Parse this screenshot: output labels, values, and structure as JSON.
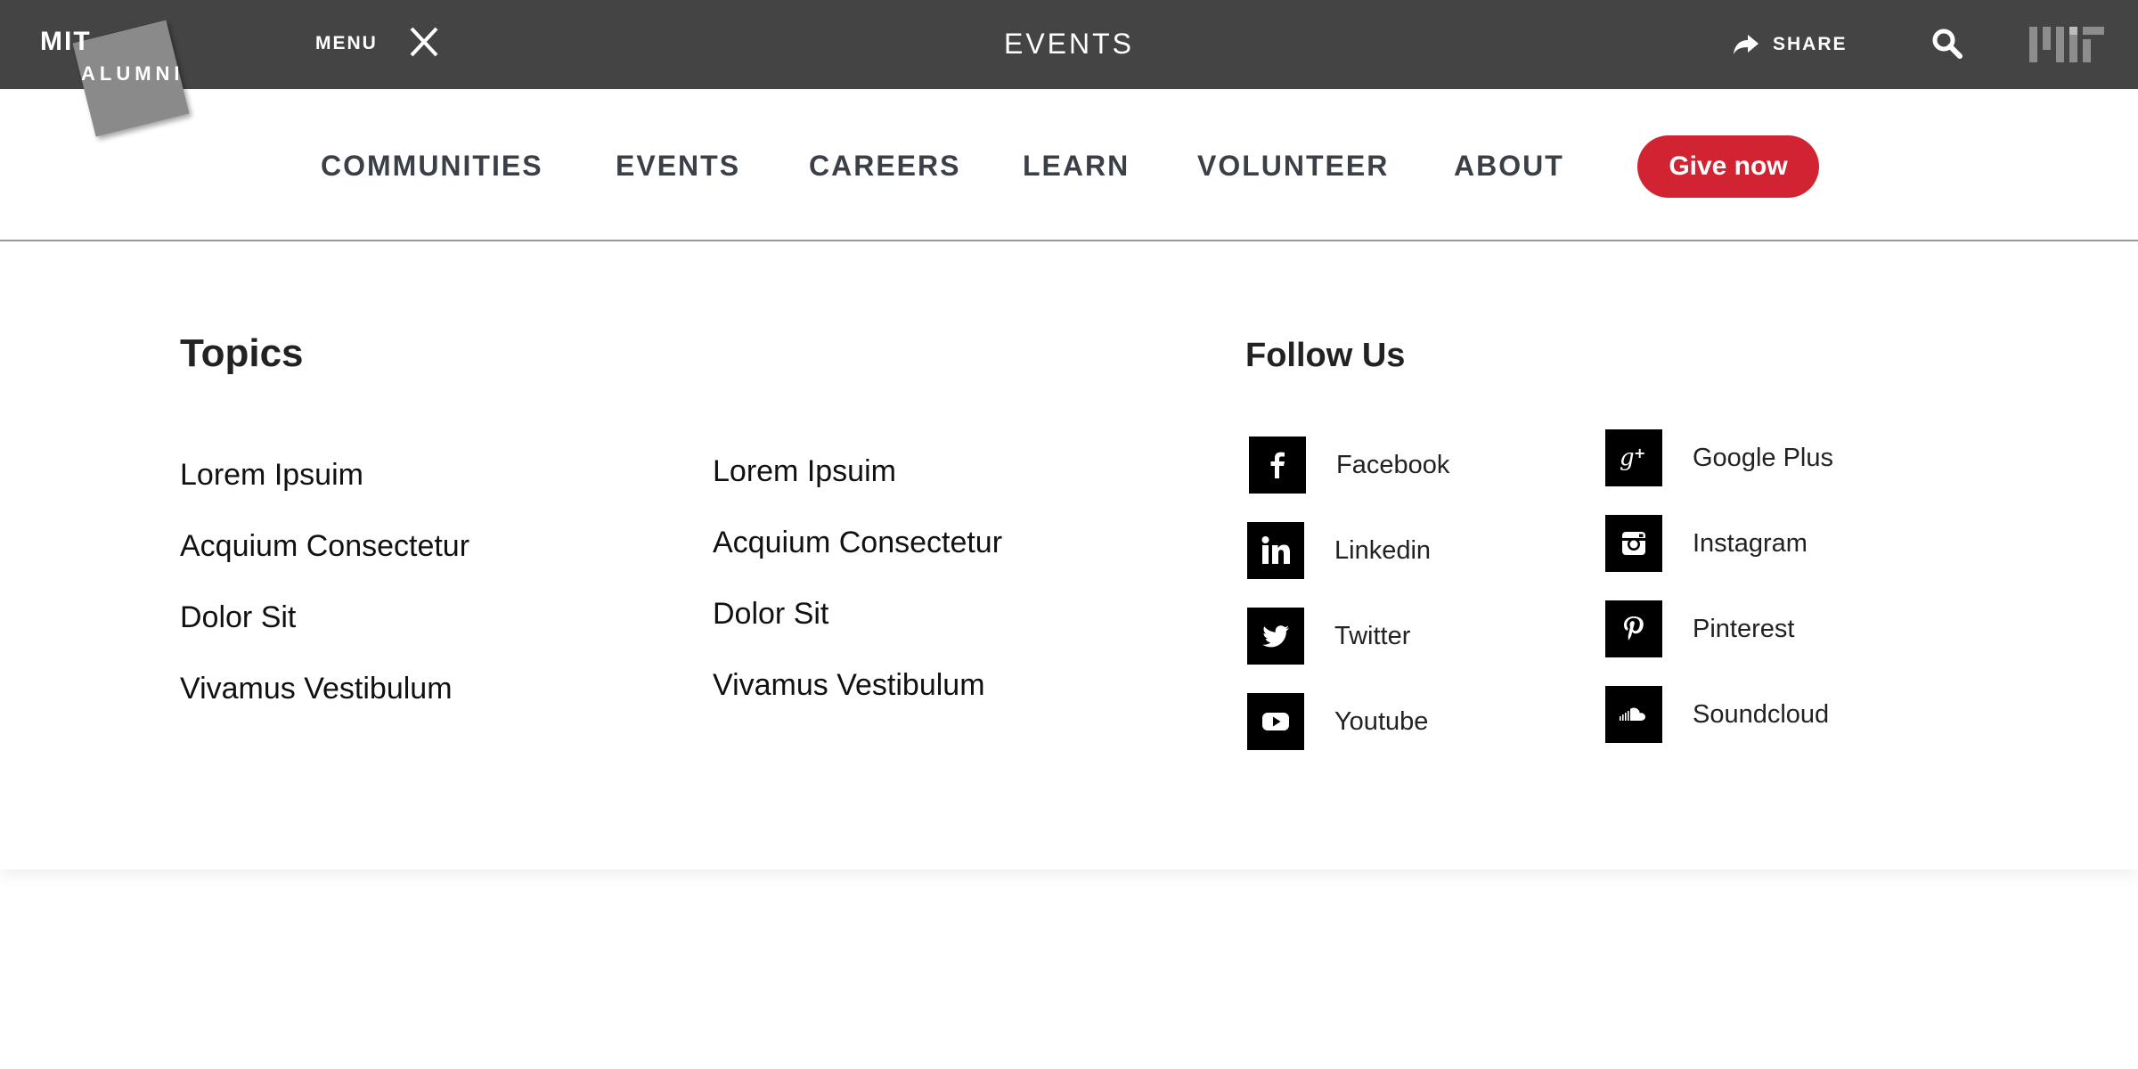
{
  "header": {
    "logo": {
      "line1": "MIT",
      "line2": "ALUMNI"
    },
    "menu_label": "MENU",
    "title": "EVENTS",
    "share_label": "SHARE"
  },
  "nav": {
    "items": [
      "COMMUNITIES",
      "EVENTS",
      "CAREERS",
      "LEARN",
      "VOLUNTEER",
      "ABOUT"
    ],
    "give_label": "Give now"
  },
  "topics": {
    "heading": "Topics",
    "col1": [
      "Lorem Ipsuim",
      "Acquium Consectetur",
      "Dolor Sit",
      "Vivamus Vestibulum"
    ],
    "col2": [
      "Lorem Ipsuim",
      "Acquium Consectetur",
      "Dolor Sit",
      "Vivamus Vestibulum"
    ]
  },
  "follow": {
    "heading": "Follow Us",
    "col1": [
      {
        "label": "Facebook",
        "icon": "facebook-icon"
      },
      {
        "label": "Linkedin",
        "icon": "linkedin-icon"
      },
      {
        "label": "Twitter",
        "icon": "twitter-icon"
      },
      {
        "label": "Youtube",
        "icon": "youtube-icon"
      }
    ],
    "col2": [
      {
        "label": "Google Plus",
        "icon": "google-plus-icon"
      },
      {
        "label": "Instagram",
        "icon": "instagram-icon"
      },
      {
        "label": "Pinterest",
        "icon": "pinterest-icon"
      },
      {
        "label": "Soundcloud",
        "icon": "soundcloud-icon"
      }
    ]
  },
  "colors": {
    "topbar": "#444444",
    "accent": "#d22333",
    "nav_text": "#3a3f48",
    "logo_square": "#8a8a8b"
  }
}
